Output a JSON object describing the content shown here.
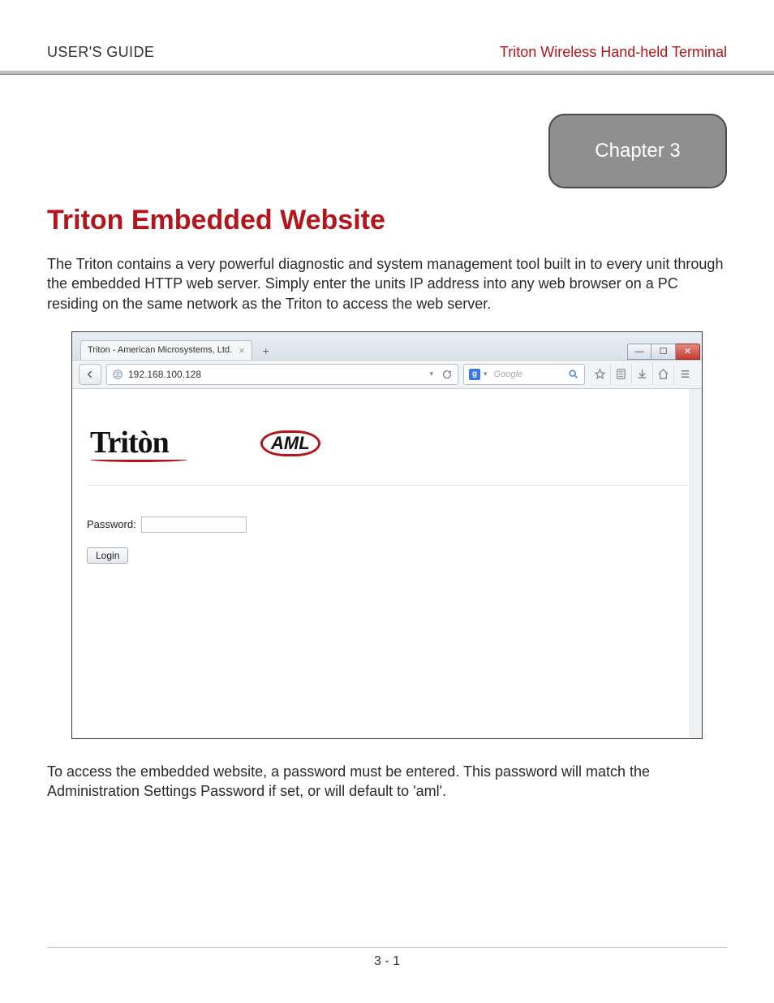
{
  "header": {
    "left": "USER'S GUIDE",
    "right": "Triton Wireless Hand-held Terminal"
  },
  "chapter_badge": "Chapter 3",
  "title": "Triton Embedded Website",
  "intro_para": "The Triton contains a very powerful diagnostic and system management tool built in to every unit through the embedded HTTP web server. Simply enter the units IP address into any web browser on a PC residing on the same network as the Triton to access the web server.",
  "browser": {
    "tab_title": "Triton - American Microsystems, Ltd.",
    "tab_close_glyph": "×",
    "tab_plus_glyph": "+",
    "url": "192.168.100.128",
    "search_engine_glyph": "g",
    "search_placeholder": "Google",
    "window_min": "—",
    "window_max": "☐",
    "window_close": "✕",
    "dropdown_glyph": "▾"
  },
  "page_content": {
    "triton_logo_text": "Tritòn",
    "aml_logo_text": "AML",
    "password_label": "Password:",
    "login_button": "Login"
  },
  "outro_para": "To access the embedded website, a password must be entered. This password will match the Administration Settings Password if set, or will default to 'aml'.",
  "footer": "3 - 1"
}
